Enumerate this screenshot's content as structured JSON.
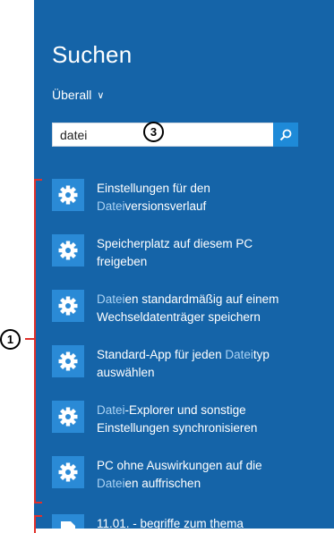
{
  "panel": {
    "title": "Suchen",
    "scope_label": "Überall",
    "search": {
      "value": "datei",
      "button_icon": "search-icon"
    }
  },
  "callouts": {
    "one": "1",
    "three": "3"
  },
  "results": [
    {
      "icon": "gear-icon",
      "lines": [
        [
          {
            "t": "Einstellungen für den",
            "h": false
          }
        ],
        [
          {
            "t": "Datei",
            "h": true
          },
          {
            "t": "versionsverlauf",
            "h": false
          }
        ]
      ]
    },
    {
      "icon": "gear-icon",
      "lines": [
        [
          {
            "t": "Speicherplatz auf diesem PC",
            "h": false
          }
        ],
        [
          {
            "t": "freigeben",
            "h": false
          }
        ]
      ]
    },
    {
      "icon": "gear-icon",
      "lines": [
        [
          {
            "t": "Datei",
            "h": true
          },
          {
            "t": "en standardmäßig auf einem",
            "h": false
          }
        ],
        [
          {
            "t": "Wechseldatenträger speichern",
            "h": false
          }
        ]
      ]
    },
    {
      "icon": "gear-icon",
      "lines": [
        [
          {
            "t": "Standard-App für jeden ",
            "h": false
          },
          {
            "t": "Datei",
            "h": true
          },
          {
            "t": "typ",
            "h": false
          }
        ],
        [
          {
            "t": "auswählen",
            "h": false
          }
        ]
      ]
    },
    {
      "icon": "gear-icon",
      "lines": [
        [
          {
            "t": "Datei",
            "h": true
          },
          {
            "t": "-Explorer und sonstige",
            "h": false
          }
        ],
        [
          {
            "t": "Einstellungen synchronisieren",
            "h": false
          }
        ]
      ]
    },
    {
      "icon": "gear-icon",
      "lines": [
        [
          {
            "t": "PC ohne Auswirkungen auf die",
            "h": false
          }
        ],
        [
          {
            "t": "Datei",
            "h": true
          },
          {
            "t": "en auffrischen",
            "h": false
          }
        ]
      ]
    },
    {
      "icon": "document-icon",
      "lines": [
        [
          {
            "t": "11.01. - begriffe zum thema",
            "h": false
          }
        ]
      ]
    }
  ],
  "colors": {
    "panel_bg": "#1564a8",
    "tile_bg": "#2a8ad6",
    "highlight": "#a9d2f4",
    "annotation": "#e0312b"
  }
}
